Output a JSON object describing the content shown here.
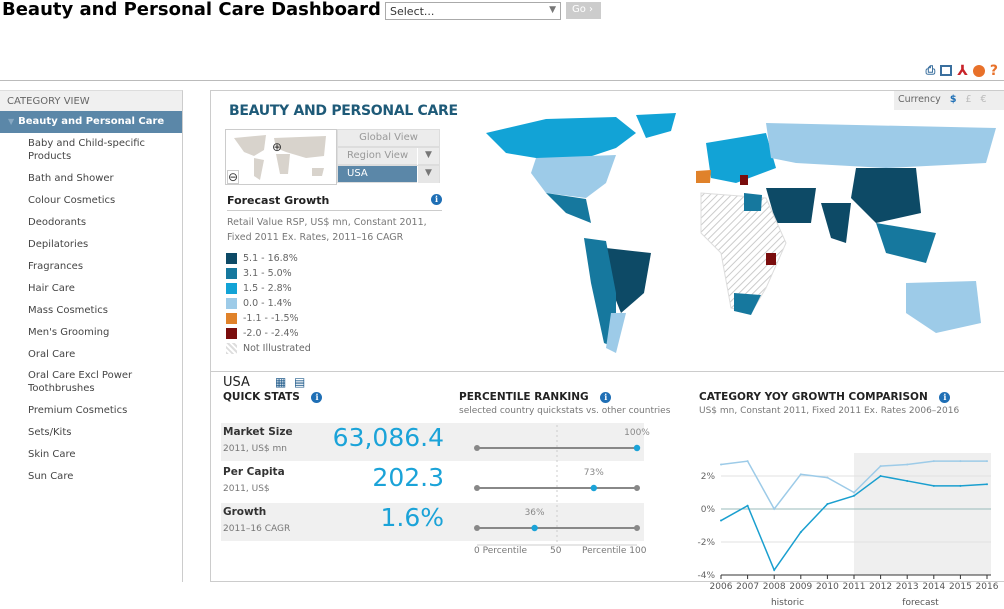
{
  "header": {
    "title": "Beauty and Personal Care Dashboard",
    "select_placeholder": "Select...",
    "go_label": "Go ›"
  },
  "toolbar": {
    "icons": [
      "print-icon",
      "image-icon",
      "pdf-icon",
      "chart-export-icon",
      "help-icon"
    ],
    "help_glyph": "?"
  },
  "sidebar": {
    "header": "CATEGORY VIEW",
    "selected": "Beauty and Personal Care",
    "items": [
      "Baby and Child-specific Products",
      "Bath and Shower",
      "Colour Cosmetics",
      "Deodorants",
      "Depilatories",
      "Fragrances",
      "Hair Care",
      "Mass Cosmetics",
      "Men's Grooming",
      "Oral Care",
      "Oral Care Excl Power Toothbrushes",
      "Premium Cosmetics",
      "Sets/Kits",
      "Skin Care",
      "Sun Care"
    ]
  },
  "map_panel": {
    "title": "BEAUTY AND PERSONAL CARE",
    "global_view": "Global View",
    "region_view": "Region View",
    "country": "USA",
    "forecast_title": "Forecast Growth",
    "forecast_sub": "Retail Value RSP, US$ mn, Constant 2011, Fixed 2011 Ex. Rates, 2011–16 CAGR",
    "legend": [
      {
        "label": "5.1 - 16.8%",
        "color": "#0d4a66"
      },
      {
        "label": "3.1 - 5.0%",
        "color": "#16789e"
      },
      {
        "label": "1.5 - 2.8%",
        "color": "#12a3d6"
      },
      {
        "label": "0.0 - 1.4%",
        "color": "#9dcbe8"
      },
      {
        "label": "-1.1 - -1.5%",
        "color": "#e0822a"
      },
      {
        "label": "-2.0 - -2.4%",
        "color": "#7a0d0d"
      },
      {
        "label": "Not Illustrated",
        "color": "hatch"
      }
    ]
  },
  "currency": {
    "label": "Currency",
    "options": [
      "$",
      "£",
      "€"
    ],
    "selected": "$"
  },
  "stats": {
    "country": "USA",
    "title": "QUICK STATS",
    "rows": [
      {
        "label": "Market Size",
        "unit": "2011, US$ mn",
        "value": "63,086.4",
        "percentile": 100,
        "percentile_label": "100%"
      },
      {
        "label": "Per Capita",
        "unit": "2011, US$",
        "value": "202.3",
        "percentile": 73,
        "percentile_label": "73%"
      },
      {
        "label": "Growth",
        "unit": "2011–16 CAGR",
        "value": "1.6%",
        "percentile": 36,
        "percentile_label": "36%"
      }
    ]
  },
  "percentile": {
    "title": "PERCENTILE RANKING",
    "sub": "selected country quickstats vs. other countries",
    "axis_min": "0 Percentile",
    "axis_mid": "50",
    "axis_max": "Percentile 100"
  },
  "chart_data": {
    "type": "line",
    "title": "CATEGORY YOY GROWTH COMPARISON",
    "subtitle": "US$ mn, Constant 2011, Fixed 2011 Ex. Rates 2006–2016",
    "x": [
      2006,
      2007,
      2008,
      2009,
      2010,
      2011,
      2012,
      2013,
      2014,
      2015,
      2016
    ],
    "ylim": [
      -4,
      3.5
    ],
    "yticks": [
      "2%",
      "0%",
      "-2%",
      "-4%"
    ],
    "ytick_values": [
      2,
      0,
      -2,
      -4
    ],
    "x_groups": [
      "historic",
      "forecast"
    ],
    "forecast_start": 2011,
    "series": [
      {
        "color": "#9dcbe8",
        "values": [
          2.7,
          2.9,
          0.0,
          2.1,
          1.9,
          1.0,
          2.6,
          2.7,
          2.9,
          2.9,
          2.9
        ]
      },
      {
        "color": "#1a9fcf",
        "values": [
          -0.7,
          0.2,
          -3.7,
          -1.4,
          0.3,
          0.8,
          2.0,
          1.7,
          1.4,
          1.4,
          1.5
        ]
      }
    ]
  }
}
